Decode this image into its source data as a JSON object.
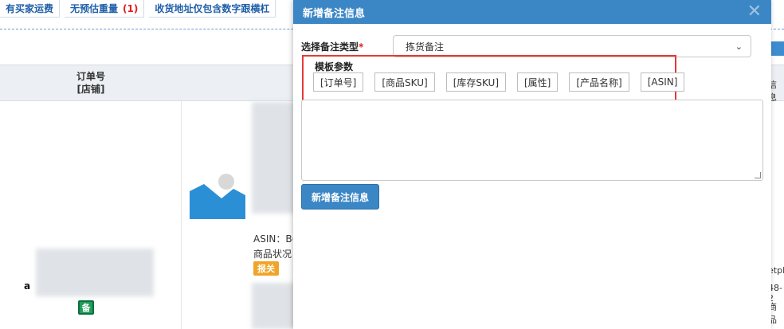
{
  "background": {
    "filters": [
      {
        "label": "有买家运费",
        "count": ""
      },
      {
        "label": "无预估重量",
        "count": "(1)"
      },
      {
        "label": "收货地址仅包含数字跟横杠",
        "count": ""
      }
    ],
    "table_header_order": "订单号",
    "table_header_shop": "[店铺]",
    "asin_prefix": "ASIN：B(",
    "condition_prefix": "商品状况：",
    "tag_baoguan": "报关",
    "tag_bei": "备",
    "amazon_mark": "a",
    "right_text_1": "etpl",
    "right_text_2": "48-2",
    "right_text_3": "商品",
    "right_header_partial": "信息"
  },
  "modal": {
    "title": "新增备注信息",
    "type_label": "选择备注类型",
    "required_mark": "*",
    "selected_type": "拣货备注",
    "params_title": "模板参数",
    "params": [
      "[订单号]",
      "[商品SKU]",
      "[库存SKU]",
      "[属性]",
      "[产品名称]",
      "[ASIN]"
    ],
    "textarea_value": "",
    "submit_label": "新增备注信息"
  },
  "colors": {
    "header_blue": "#3b87c6",
    "highlight_red": "#e53935",
    "filter_blue": "#1f5fa8",
    "badge_orange": "#f0a52a",
    "badge_green": "#1e9e5b"
  }
}
